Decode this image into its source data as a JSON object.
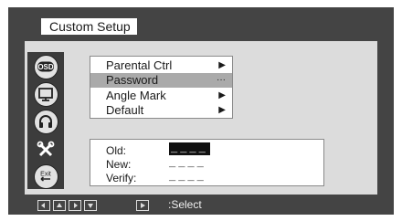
{
  "window": {
    "title": "Custom Setup"
  },
  "sidebar": {
    "items": [
      {
        "icon": "osd-icon",
        "label": "OSD"
      },
      {
        "icon": "monitor-icon",
        "label": ""
      },
      {
        "icon": "headphones-icon",
        "label": ""
      },
      {
        "icon": "tools-icon",
        "label": ""
      },
      {
        "icon": "exit-icon",
        "label": "Exit"
      }
    ]
  },
  "menu": {
    "items": [
      {
        "label": "Parental Ctrl",
        "indicator": "▶"
      },
      {
        "label": "Password",
        "indicator": "···"
      },
      {
        "label": "Angle Mark",
        "indicator": "▶"
      },
      {
        "label": "Default",
        "indicator": "▶"
      }
    ],
    "highlighted_index": 1
  },
  "password": {
    "rows": [
      {
        "label": "Old:",
        "value": "____"
      },
      {
        "label": "New:",
        "value": "____"
      },
      {
        "label": "Verify:",
        "value": "____"
      }
    ]
  },
  "footer": {
    "nav_icons": [
      "left-arrow-icon",
      "up-arrow-icon",
      "right-arrow-icon",
      "down-arrow-icon",
      "play-icon"
    ],
    "select_label": ":Select"
  },
  "colors": {
    "frame": "#444444",
    "content": "#dcdcdc",
    "highlight": "#aaaaaa"
  }
}
